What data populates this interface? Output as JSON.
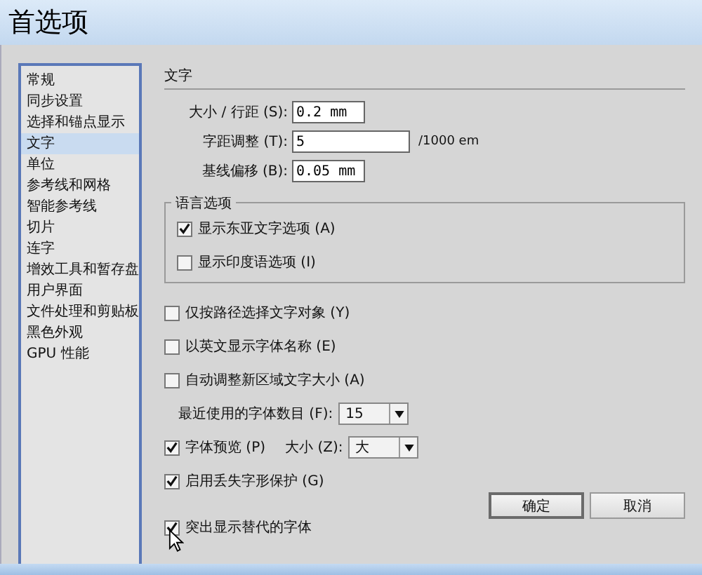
{
  "window": {
    "title": "首选项"
  },
  "sidebar": {
    "items": [
      {
        "label": "常规",
        "selected": false
      },
      {
        "label": "同步设置",
        "selected": false
      },
      {
        "label": "选择和锚点显示",
        "selected": false
      },
      {
        "label": "文字",
        "selected": true
      },
      {
        "label": "单位",
        "selected": false
      },
      {
        "label": "参考线和网格",
        "selected": false
      },
      {
        "label": "智能参考线",
        "selected": false
      },
      {
        "label": "切片",
        "selected": false
      },
      {
        "label": "连字",
        "selected": false
      },
      {
        "label": "增效工具和暂存盘",
        "selected": false
      },
      {
        "label": "用户界面",
        "selected": false
      },
      {
        "label": "文件处理和剪贴板",
        "selected": false
      },
      {
        "label": "黑色外观",
        "selected": false
      },
      {
        "label": "GPU 性能",
        "selected": false
      }
    ]
  },
  "section": {
    "title": "文字"
  },
  "fields": [
    {
      "label": "大小 / 行距 (S):",
      "value": "0.2 mm"
    },
    {
      "label": "字距调整 (T):",
      "value": "5",
      "unit": "/1000 em"
    },
    {
      "label": "基线偏移 (B):",
      "value": "0.05 mm"
    }
  ],
  "language_options": {
    "title": "语言选项",
    "items": [
      {
        "label": "显示东亚文字选项 (A)",
        "checked": true
      },
      {
        "label": "显示印度语选项 (I)",
        "checked": false
      }
    ]
  },
  "options": [
    {
      "kind": "checkbox",
      "label": "仅按路径选择文字对象 (Y)",
      "checked": false
    },
    {
      "kind": "checkbox",
      "label": "以英文显示字体名称 (E)",
      "checked": false
    },
    {
      "kind": "checkbox",
      "label": "自动调整新区域文字大小 (A)",
      "checked": false
    },
    {
      "kind": "select",
      "label": "最近使用的字体数目 (F):",
      "value": "15"
    },
    {
      "kind": "checkbox_select",
      "label": "字体预览 (P)",
      "checked": true,
      "select_label": "大小 (Z):",
      "value": "大"
    },
    {
      "kind": "checkbox",
      "label": "启用丢失字形保护 (G)",
      "checked": true
    }
  ],
  "footer_option": {
    "label": "突出显示替代的字体",
    "checked": true
  },
  "buttons": [
    {
      "label": "确定",
      "default": true
    },
    {
      "label": "取消",
      "default": false
    }
  ]
}
